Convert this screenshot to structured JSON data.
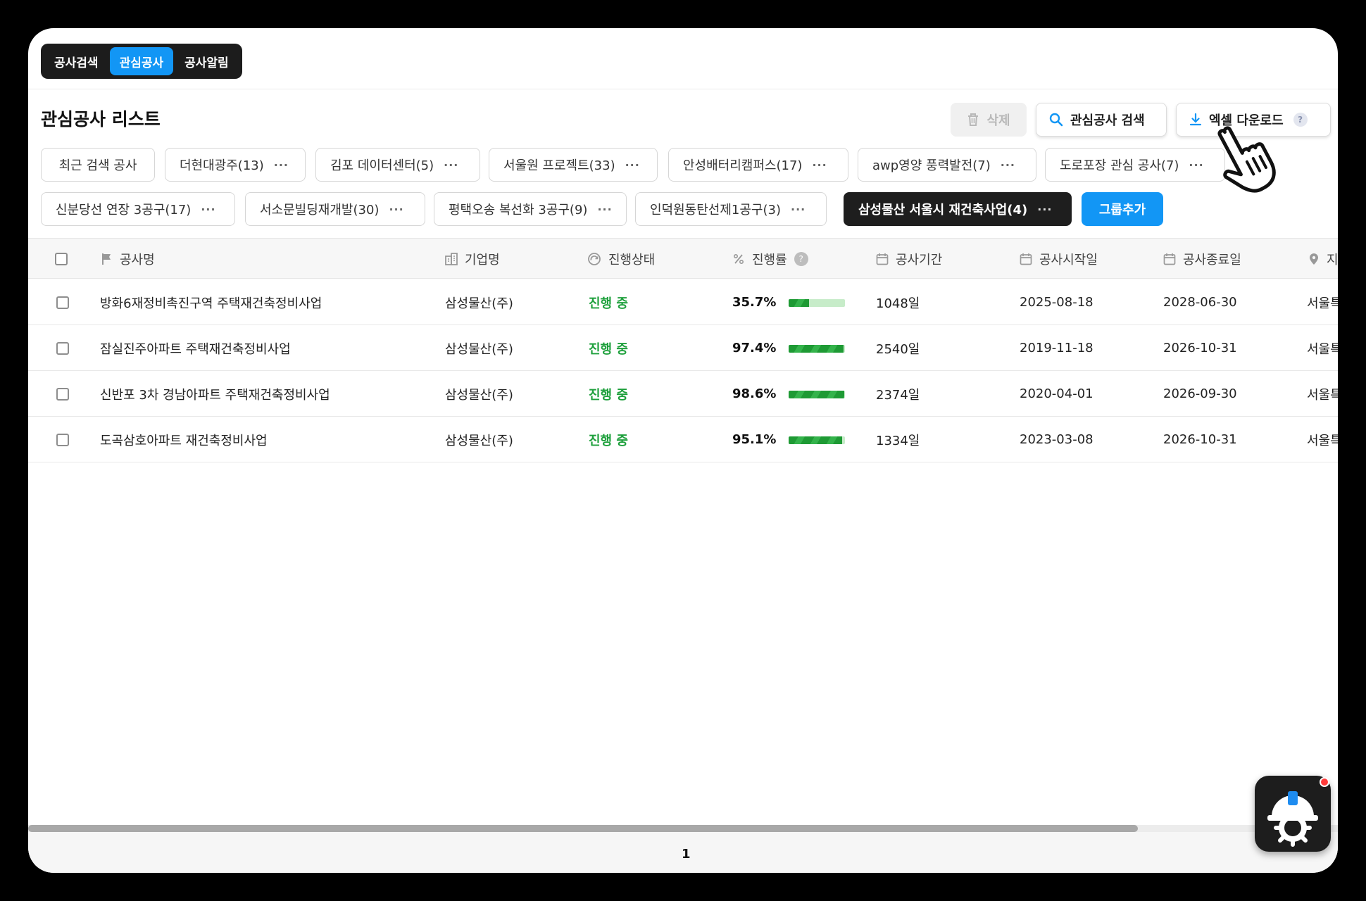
{
  "tabs": [
    {
      "label": "공사검색",
      "active": false
    },
    {
      "label": "관심공사",
      "active": true
    },
    {
      "label": "공사알림",
      "active": false
    }
  ],
  "page_title": "관심공사 리스트",
  "actions": {
    "delete_label": "삭제",
    "search_label": "관심공사 검색",
    "excel_label": "엑셀 다운로드",
    "help_mark": "?"
  },
  "groups_row1": [
    {
      "label": "최근 검색 공사",
      "more": ""
    },
    {
      "label": "더현대광주(13)",
      "more": "···"
    },
    {
      "label": "김포 데이터센터(5)",
      "more": "···"
    },
    {
      "label": "서울원 프로젝트(33)",
      "more": "···"
    },
    {
      "label": "안성배터리캠퍼스(17)",
      "more": "···"
    },
    {
      "label": "awp영양 풍력발전(7)",
      "more": "···"
    },
    {
      "label": "도로포장 관심 공사(7)",
      "more": "···"
    }
  ],
  "groups_row2": [
    {
      "label": "신분당선 연장 3공구(17)",
      "more": "···"
    },
    {
      "label": "서소문빌딩재개발(30)",
      "more": "···"
    },
    {
      "label": "평택오송 복선화 3공구(9)",
      "more": "···"
    },
    {
      "label": "인덕원동탄선제1공구(3)",
      "more": "···"
    },
    {
      "label": "삼성물산 서울시 재건축사업(4)",
      "more": "···"
    }
  ],
  "add_group_label": "그룹추가",
  "columns": {
    "name": "공사명",
    "company": "기업명",
    "status": "진행상태",
    "progress": "진행률",
    "progress_help": "?",
    "duration": "공사기간",
    "start": "공사시작일",
    "end": "공사종료일",
    "region": "지"
  },
  "rows": [
    {
      "name": "방화6재정비촉진구역 주택재건축정비사업",
      "company": "삼성물산(주)",
      "status": "진행 중",
      "progress_text": "35.7%",
      "progress": 0.357,
      "duration": "1048일",
      "start": "2025-08-18",
      "end": "2028-06-30",
      "region": "서울특"
    },
    {
      "name": "잠실진주아파트 주택재건축정비사업",
      "company": "삼성물산(주)",
      "status": "진행 중",
      "progress_text": "97.4%",
      "progress": 0.974,
      "duration": "2540일",
      "start": "2019-11-18",
      "end": "2026-10-31",
      "region": "서울특"
    },
    {
      "name": "신반포 3차 경남아파트 주택재건축정비사업",
      "company": "삼성물산(주)",
      "status": "진행 중",
      "progress_text": "98.6%",
      "progress": 0.986,
      "duration": "2374일",
      "start": "2020-04-01",
      "end": "2026-09-30",
      "region": "서울특"
    },
    {
      "name": "도곡삼호아파트 재건축정비사업",
      "company": "삼성물산(주)",
      "status": "진행 중",
      "progress_text": "95.1%",
      "progress": 0.951,
      "duration": "1334일",
      "start": "2023-03-08",
      "end": "2026-10-31",
      "region": "서울특"
    }
  ],
  "pagination": {
    "current": "1"
  },
  "colors": {
    "accent": "#1296f5",
    "status_green": "#1ea03c",
    "dark": "#1e1e1e"
  }
}
